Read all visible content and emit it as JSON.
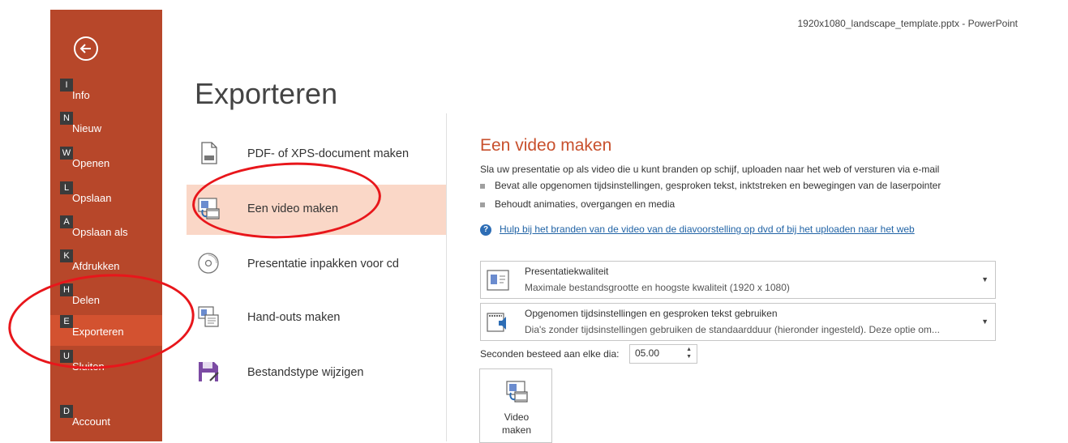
{
  "window": {
    "title": "1920x1080_landscape_template.pptx  -  PowerPoint"
  },
  "sidebar": {
    "items": [
      {
        "key": "I",
        "label": "Info"
      },
      {
        "key": "N",
        "label": "Nieuw"
      },
      {
        "key": "W",
        "label": "Openen"
      },
      {
        "key": "L",
        "label": "Opslaan"
      },
      {
        "key": "A",
        "label": "Opslaan als"
      },
      {
        "key": "K",
        "label": "Afdrukken"
      },
      {
        "key": "H",
        "label": "Delen"
      },
      {
        "key": "E",
        "label": "Exporteren",
        "active": true
      },
      {
        "key": "U",
        "label": "Sluiten"
      },
      {
        "key": "D",
        "label": "Account"
      }
    ]
  },
  "page": {
    "title": "Exporteren"
  },
  "export_options": [
    {
      "label": "PDF- of XPS-document maken",
      "icon": "pdf-document-icon"
    },
    {
      "label": "Een video maken",
      "icon": "video-icon",
      "active": true
    },
    {
      "label": "Presentatie inpakken voor cd",
      "icon": "cd-icon"
    },
    {
      "label": "Hand-outs maken",
      "icon": "handouts-icon"
    },
    {
      "label": "Bestandstype wijzigen",
      "icon": "save-filetype-icon"
    }
  ],
  "detail": {
    "title": "Een video maken",
    "description": "Sla uw presentatie op als video die u kunt branden op schijf, uploaden naar het web of versturen via e-mail",
    "bullets": [
      "Bevat alle opgenomen tijdsinstellingen, gesproken tekst, inktstreken en bewegingen van de laserpointer",
      "Behoudt animaties, overgangen en media"
    ],
    "help_link": "Hulp bij het branden van de video van de diavoorstelling op dvd of bij het uploaden naar het web",
    "quality": {
      "title": "Presentatiekwaliteit",
      "subtitle": "Maximale bestandsgrootte en hoogste kwaliteit (1920 x 1080)"
    },
    "timings": {
      "title": "Opgenomen tijdsinstellingen en gesproken tekst gebruiken",
      "subtitle": "Dia's zonder tijdsinstellingen gebruiken de standaardduur (hieronder ingesteld). Deze optie om..."
    },
    "seconds_label": "Seconden besteed aan elke dia:",
    "seconds_value": "05.00",
    "create_button": {
      "line1": "Video",
      "line2": "maken"
    }
  },
  "colors": {
    "accent": "#b7472a",
    "active_nav": "#d35230",
    "active_option": "#fad7c7",
    "annotation": "#e8161b"
  }
}
